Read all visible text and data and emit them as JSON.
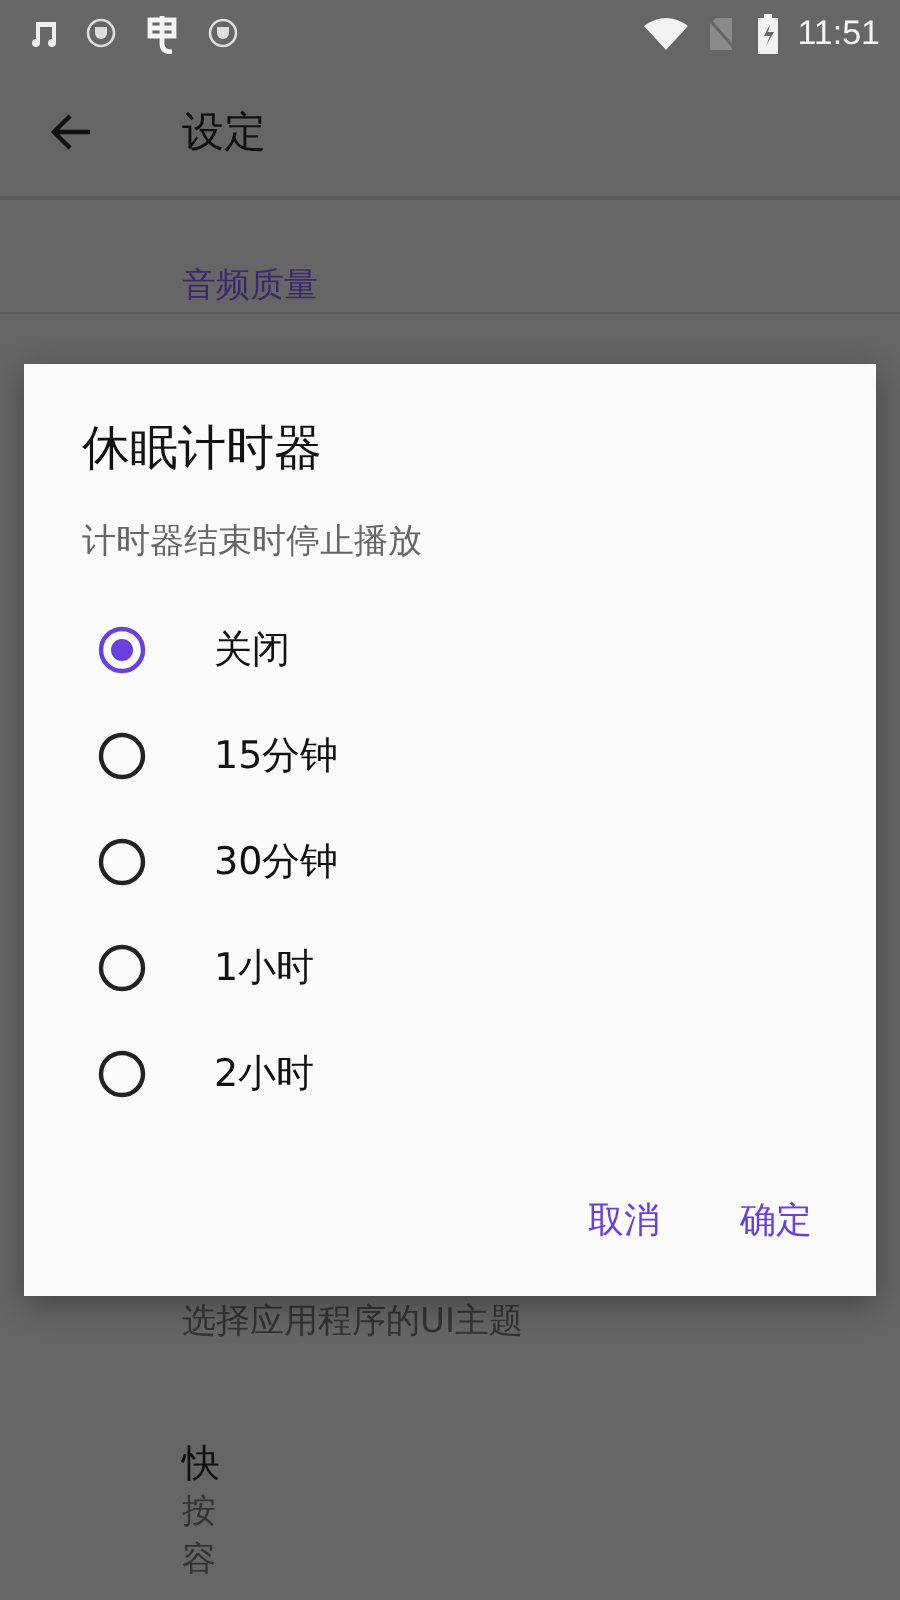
{
  "status_bar": {
    "time": "11:51"
  },
  "app_bar": {
    "title": "设定"
  },
  "settings": {
    "category": "音频质量",
    "theme_summary": "选择应用程序的UI主题",
    "last_item": {
      "title": "快",
      "summary_lines": [
        "按",
        "容"
      ]
    }
  },
  "dialog": {
    "title": "休眠计时器",
    "message": "计时器结束时停止播放",
    "options": [
      {
        "label": "关闭",
        "selected": true
      },
      {
        "label": "15分钟",
        "selected": false
      },
      {
        "label": "30分钟",
        "selected": false
      },
      {
        "label": "1小时",
        "selected": false
      },
      {
        "label": "2小时",
        "selected": false
      }
    ],
    "buttons": [
      {
        "label": "取消"
      },
      {
        "label": "确定"
      }
    ]
  }
}
